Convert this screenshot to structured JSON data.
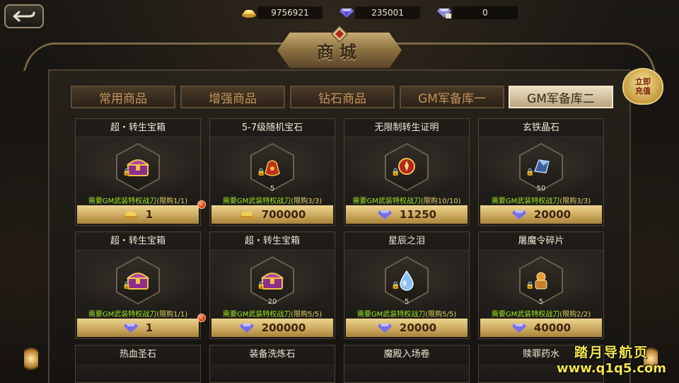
{
  "resources": {
    "gold": "9756921",
    "diamond": "235001",
    "bound_diamond": "0"
  },
  "title": "商城",
  "recharge_button": [
    "立即",
    "充值"
  ],
  "tabs": [
    {
      "label": "常用商品",
      "active": false
    },
    {
      "label": "增强商品",
      "active": false
    },
    {
      "label": "钻石商品",
      "active": false
    },
    {
      "label": "GM军备库一",
      "active": false
    },
    {
      "label": "GM军备库二",
      "active": true
    }
  ],
  "items": [
    {
      "name": "超・转生宝箱",
      "icon": "treasure-chest-icon",
      "count": "",
      "req": "需要GM武装特权战刀",
      "limit": "(限购1/1)",
      "currency": "gold-ingot-icon",
      "price": "1",
      "dot": true
    },
    {
      "name": "5-7级随机宝石",
      "icon": "gem-bag-icon",
      "count": "5",
      "req": "需要GM武装特权战刀",
      "limit": "(限购3/3)",
      "currency": "gold-ingot-icon",
      "price": "700000",
      "dot": false
    },
    {
      "name": "无限制转生证明",
      "icon": "badge-icon",
      "count": "",
      "req": "需要GM武装特权战刀",
      "limit": "(限购10/10)",
      "currency": "diamond-icon",
      "price": "11250",
      "dot": false
    },
    {
      "name": "玄铁晶石",
      "icon": "crystal-ore-icon",
      "count": "50",
      "req": "需要GM武装特权战刀",
      "limit": "(限购3/3)",
      "currency": "diamond-icon",
      "price": "20000",
      "dot": false
    },
    {
      "name": "超・转生宝箱",
      "icon": "treasure-chest-icon",
      "count": "",
      "req": "需要GM武装特权战刀",
      "limit": "(限购1/1)",
      "currency": "diamond-icon",
      "price": "1",
      "dot": true
    },
    {
      "name": "超・转生宝箱",
      "icon": "treasure-chest-icon",
      "count": "20",
      "req": "需要GM武装特权战刀",
      "limit": "(限购5/5)",
      "currency": "diamond-icon",
      "price": "200000",
      "dot": false
    },
    {
      "name": "星辰之泪",
      "icon": "teardrop-icon",
      "count": "5",
      "req": "需要GM武装特权战刀",
      "limit": "(限购5/5)",
      "currency": "diamond-icon",
      "price": "20000",
      "dot": false
    },
    {
      "name": "屠魔令碎片",
      "icon": "armor-fragment-icon",
      "count": "5",
      "req": "需要GM武装特权战刀",
      "limit": "(限购2/2)",
      "currency": "diamond-icon",
      "price": "40000",
      "dot": false
    }
  ],
  "partial_items": [
    "热血圣石",
    "装备洗炼石",
    "魔殿入场卷",
    "赎罪药水"
  ],
  "watermark": {
    "line1": "踏月导航页",
    "line2": "www.q1q5.com"
  },
  "colors": {
    "gold_accent": "#c9a55a",
    "req_green": "#9ee81e",
    "limit_yellow": "#e0d45f"
  }
}
